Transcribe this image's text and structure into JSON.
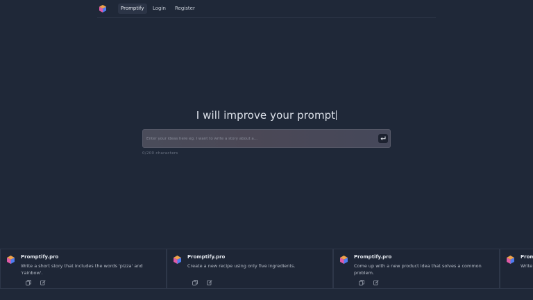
{
  "nav": {
    "logo_icon": "cube-logo-icon",
    "items": [
      {
        "label": "Promptify",
        "active": true
      },
      {
        "label": "Login",
        "active": false
      },
      {
        "label": "Register",
        "active": false
      }
    ]
  },
  "hero": {
    "title": "I will improve your prompt",
    "input_placeholder": "Enter your ideas here eg. I want to write a story about a...",
    "input_value": "",
    "submit_icon": "enter-return-icon",
    "char_count": "0/200 characters"
  },
  "cards": [
    {
      "title": "Promptify.pro",
      "text": "Write a short story that includes the words 'pizza' and 'rainbow'.",
      "icon": "cube-logo-icon"
    },
    {
      "title": "Promptify.pro",
      "text": "Create a new recipe using only five ingredients.",
      "icon": "cube-logo-icon"
    },
    {
      "title": "Promptify.pro",
      "text": "Come up with a new product idea that solves a common problem.",
      "icon": "cube-logo-icon"
    },
    {
      "title": "Promptify.pro",
      "text": "Write",
      "icon": "cube-logo-icon"
    }
  ],
  "colors": {
    "background": "#1f2838",
    "input_gradient": "#4a4c5a",
    "accent_cube_blue": "#4f7cf0",
    "accent_cube_pink": "#e05aa6",
    "accent_cube_orange": "#f0a24a"
  }
}
